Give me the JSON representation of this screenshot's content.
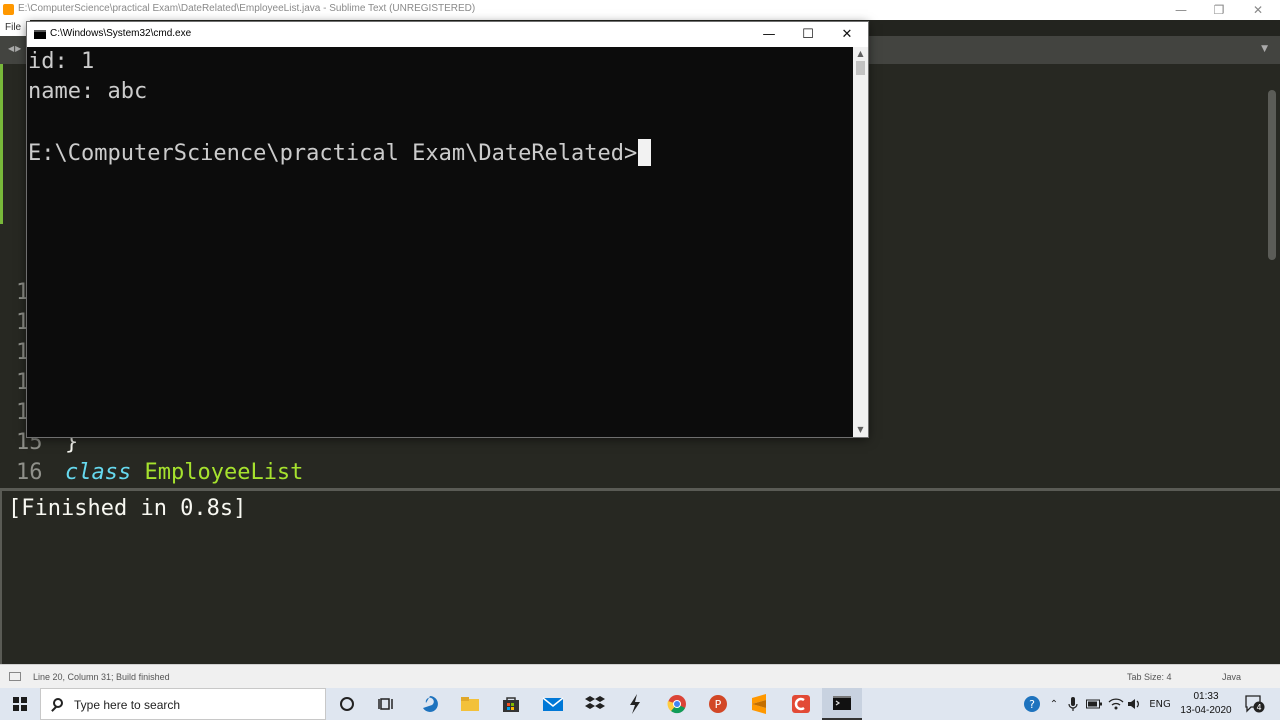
{
  "sublime": {
    "window_title": "E:\\ComputerScience\\practical Exam\\DateRelated\\EmployeeList.java - Sublime Text (UNREGISTERED)",
    "menu": {
      "file": "File"
    },
    "gutter": [
      "1",
      "1",
      "1",
      "1",
      "1",
      "15",
      "16"
    ],
    "code": {
      "brace": "}",
      "keyword": "class",
      "class_name": "EmployeeList"
    },
    "output": "[Finished in 0.8s]",
    "status": {
      "text": "Line 20, Column 31; Build finished",
      "tab_size": "Tab Size: 4",
      "syntax": "Java"
    }
  },
  "cmd": {
    "title": "C:\\Windows\\System32\\cmd.exe",
    "lines": [
      "id: 1",
      "name: abc",
      "",
      "E:\\ComputerScience\\practical Exam\\DateRelated>"
    ]
  },
  "taskbar": {
    "search_placeholder": "Type here to search",
    "language": "ENG",
    "time": "01:33",
    "date": "13-04-2020",
    "notifications": "4",
    "apps": [
      "cortana-icon",
      "task-view-icon",
      "edge-icon",
      "file-explorer-icon",
      "store-icon",
      "mail-icon",
      "dropbox-icon",
      "bolt-icon",
      "chrome-icon",
      "powerpoint-icon",
      "sublime-text-icon",
      "app-icon",
      "command-prompt-icon"
    ]
  },
  "colors": {
    "editor_bg": "#272822",
    "keyword": "#66d9ef",
    "class_name": "#a6e22e",
    "gutter": "#8f908a",
    "cmd_bg": "#0c0c0c",
    "cmd_text": "#cccccc",
    "taskbar_bg": "#dfe6f0"
  }
}
